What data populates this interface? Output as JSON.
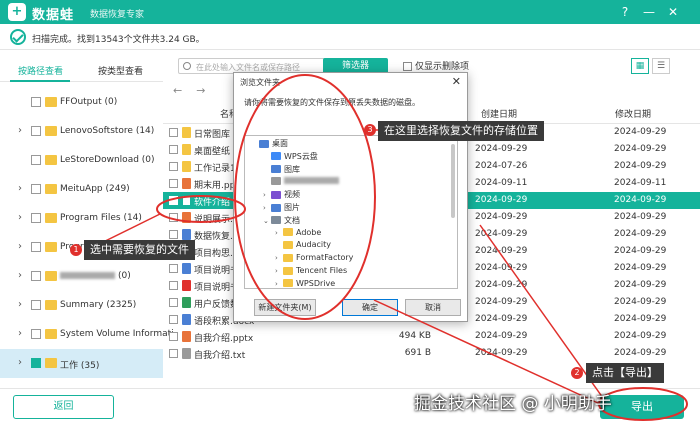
{
  "app": {
    "name": "数据蛙",
    "subtitle": "数据恢复专家",
    "help_icon": "?",
    "minimize_icon": "—",
    "close_icon": "✕"
  },
  "status": {
    "text": "扫描完成。找到13543个文件共3.24 GB。"
  },
  "left_tabs": [
    {
      "label": "按路径查看",
      "active": true
    },
    {
      "label": "按类型查看",
      "active": false
    }
  ],
  "tree": [
    {
      "label": "FFOutput (0)",
      "expand": false,
      "redacted": false,
      "selected": false
    },
    {
      "label": "LenovoSoftstore (14)",
      "expand": true,
      "redacted": false,
      "selected": false
    },
    {
      "label": "LeStoreDownload (0)",
      "expand": false,
      "redacted": false,
      "selected": false
    },
    {
      "label": "MeituApp (249)",
      "expand": true,
      "redacted": false,
      "selected": false
    },
    {
      "label": "Program Files (14)",
      "expand": true,
      "redacted": false,
      "selected": false
    },
    {
      "label": "Program Files (x86) (1976",
      "expand": true,
      "redacted": false,
      "selected": false
    },
    {
      "label": "(0)",
      "expand": true,
      "redacted": true,
      "selected": false
    },
    {
      "label": "Summary (2325)",
      "expand": true,
      "redacted": false,
      "selected": false
    },
    {
      "label": "System Volume Informati",
      "expand": true,
      "redacted": false,
      "selected": false
    },
    {
      "label": "工作 (35)",
      "expand": true,
      "redacted": false,
      "selected": true
    }
  ],
  "toolbar": {
    "search_placeholder": "在此处输入文件名或保存路径",
    "filter_label": "筛选器",
    "only_deleted_label": "仅显示删除项",
    "nav": "←→"
  },
  "table": {
    "headers": {
      "name": "名称",
      "size": "大小",
      "created": "创建日期",
      "modified": "修改日期"
    },
    "rows": [
      {
        "name": "日常图库",
        "size": "",
        "created": "2024-09-29",
        "modified": "2024-09-29",
        "icon_color": "#f4c542",
        "selected": false
      },
      {
        "name": "桌面壁纸",
        "size": "",
        "created": "2024-09-29",
        "modified": "2024-09-29",
        "icon_color": "#f4c542",
        "selected": false
      },
      {
        "name": "工作记录1.",
        "size": "",
        "created": "2024-07-26",
        "modified": "2024-09-29",
        "icon_color": "#f4c542",
        "selected": false
      },
      {
        "name": "期末用.pp",
        "size": "",
        "created": "2024-09-11",
        "modified": "2024-09-11",
        "icon_color": "#e8733a",
        "selected": false
      },
      {
        "name": "软件介绍",
        "size": "",
        "created": "2024-09-29",
        "modified": "2024-09-29",
        "icon_color": "#ffffff",
        "selected": true
      },
      {
        "name": "说明展示.p",
        "size": "",
        "created": "2024-09-29",
        "modified": "2024-09-29",
        "icon_color": "#e8733a",
        "selected": false
      },
      {
        "name": "数据恢复.t",
        "size": "",
        "created": "2024-09-29",
        "modified": "2024-09-29",
        "icon_color": "#4a7fd4",
        "selected": false
      },
      {
        "name": "项目构思.d",
        "size": "",
        "created": "2024-09-29",
        "modified": "2024-09-29",
        "icon_color": "#4a7fd4",
        "selected": false
      },
      {
        "name": "项目说明书",
        "size": "",
        "created": "2024-09-29",
        "modified": "2024-09-29",
        "icon_color": "#4a7fd4",
        "selected": false
      },
      {
        "name": "项目说明书",
        "size": "",
        "created": "2024-09-29",
        "modified": "2024-09-29",
        "icon_color": "#e0302c",
        "selected": false
      },
      {
        "name": "用户反馈数据汇总表",
        "size": "",
        "created": "2024-09-29",
        "modified": "2024-09-29",
        "icon_color": "#2e9e5b",
        "selected": false
      },
      {
        "name": "语段积累.docx",
        "size": "1.11 MB",
        "created": "2024-09-29",
        "modified": "2024-09-29",
        "icon_color": "#4a7fd4",
        "selected": false
      },
      {
        "name": "自我介绍.pptx",
        "size": "494 KB",
        "created": "2024-09-29",
        "modified": "2024-09-29",
        "icon_color": "#e8733a",
        "selected": false
      },
      {
        "name": "自我介绍.txt",
        "size": "691 B",
        "created": "2024-09-29",
        "modified": "2024-09-29",
        "icon_color": "#9a9a9a",
        "selected": false
      }
    ]
  },
  "bottom": {
    "back_label": "返回",
    "export_label": "导出"
  },
  "dialog": {
    "title": "浏览文件夹",
    "close_icon": "✕",
    "message": "请你将需要恢复的文件保存到原丢失数据的磁盘。",
    "tree": [
      {
        "label": "桌面",
        "level": 0,
        "expand": "",
        "icon_color": "#4a7fd4"
      },
      {
        "label": "WPS云盘",
        "level": 1,
        "expand": "",
        "icon_color": "#3d8af7"
      },
      {
        "label": "图库",
        "level": 1,
        "expand": "",
        "icon_color": "#4a7fd4"
      },
      {
        "label": "",
        "level": 1,
        "expand": "",
        "icon_color": "#999999",
        "redacted": true
      },
      {
        "label": "视频",
        "level": 1,
        "expand": "›",
        "icon_color": "#7b4fd1"
      },
      {
        "label": "图片",
        "level": 1,
        "expand": "›",
        "icon_color": "#4a7fd4"
      },
      {
        "label": "文档",
        "level": 1,
        "expand": "⌄",
        "icon_color": "#7c8a99"
      },
      {
        "label": "Adobe",
        "level": 2,
        "expand": "›",
        "icon_color": "#f4c542"
      },
      {
        "label": "Audacity",
        "level": 2,
        "expand": "",
        "icon_color": "#f4c542"
      },
      {
        "label": "FormatFactory",
        "level": 2,
        "expand": "›",
        "icon_color": "#f4c542"
      },
      {
        "label": "Tencent Files",
        "level": 2,
        "expand": "›",
        "icon_color": "#f4c542"
      },
      {
        "label": "WPSDrive",
        "level": 2,
        "expand": "›",
        "icon_color": "#f4c542"
      }
    ],
    "new_folder_label": "新建文件夹(M)",
    "ok_label": "确定",
    "cancel_label": "取消"
  },
  "annotations": {
    "step1": {
      "num": "1",
      "text": "选中需要恢复的文件"
    },
    "step2": {
      "num": "2",
      "text": "点击【导出】"
    },
    "step3": {
      "num": "3",
      "text": "在这里选择恢复文件的存储位置"
    },
    "color": "#e0302c"
  },
  "watermark": "掘金技术社区 @ 小明助手"
}
